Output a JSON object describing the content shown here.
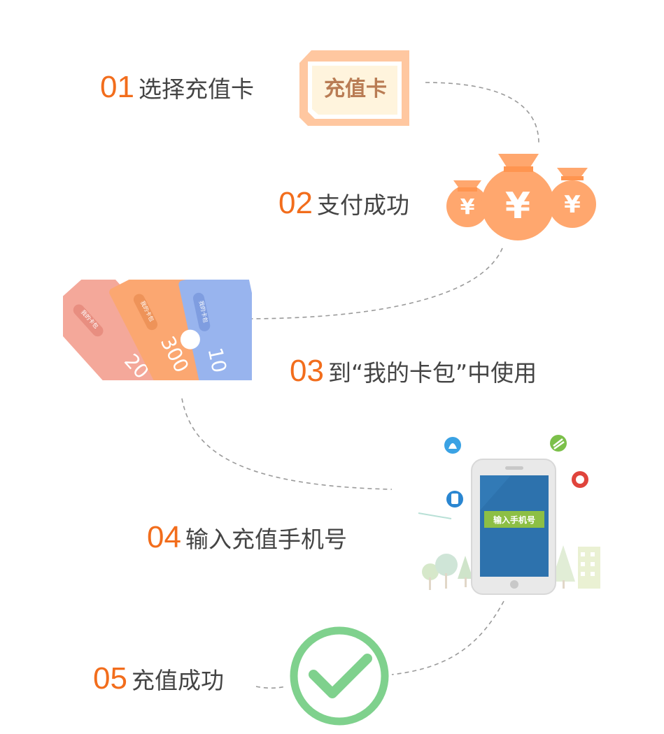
{
  "steps": [
    {
      "num": "01",
      "label": "选择充值卡"
    },
    {
      "num": "02",
      "label": "支付成功"
    },
    {
      "num": "03",
      "label": "到“我的卡包”中使用"
    },
    {
      "num": "04",
      "label": "输入充值手机号"
    },
    {
      "num": "05",
      "label": "充值成功"
    }
  ],
  "card_icon": {
    "text": "充值卡"
  },
  "money_bags": {
    "symbol": "¥"
  },
  "coupons": {
    "tag": "我的卡包",
    "values": [
      "20",
      "300",
      "10"
    ]
  },
  "phone": {
    "screen_text": "输入手机号"
  },
  "colors": {
    "accent": "#f26d1c",
    "label": "#444444",
    "card": "#ffb88c",
    "bag": "#ffa76e",
    "phone_screen": "#2d72ad",
    "phone_badge": "#8dbf45",
    "check": "#7fd18d"
  }
}
